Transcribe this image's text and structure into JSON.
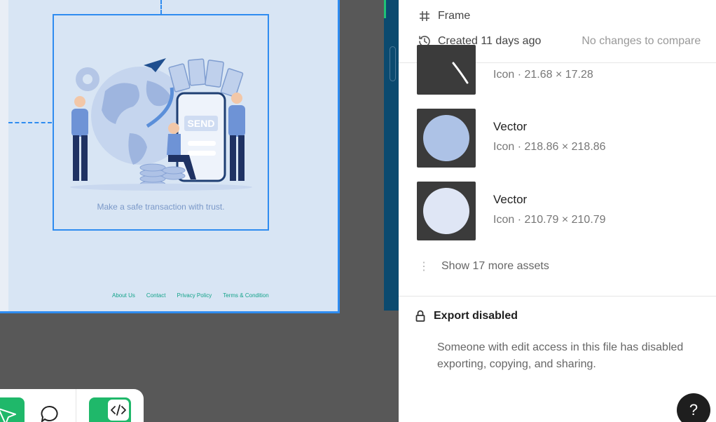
{
  "canvas": {
    "caption": "Make a safe transaction with trust.",
    "send_label": "SEND",
    "footer_links": [
      "About Us",
      "Contact",
      "Privacy Policy",
      "Terms & Condition"
    ]
  },
  "toolbar": {
    "tools": [
      "move-tool",
      "comment-tool",
      "dev-mode-toggle"
    ]
  },
  "panel": {
    "frame_label": "Frame",
    "created": "Created 11 days ago",
    "compare": "No changes to compare",
    "assets": [
      {
        "name": "",
        "meta": "Icon · 21.68 × 17.28",
        "swatch": "#3b3b3b"
      },
      {
        "name": "Vector",
        "meta": "Icon · 218.86 × 218.86",
        "swatch": "#adc2e6"
      },
      {
        "name": "Vector",
        "meta": "Icon · 210.79 × 210.79",
        "swatch": "#dfe6f5"
      }
    ],
    "show_more": "Show 17 more assets",
    "export_title": "Export disabled",
    "export_desc": "Someone with edit access in this file has disabled exporting, copying, and sharing.",
    "help": "?"
  },
  "colors": {
    "selection": "#2f8cf0",
    "accent_green": "#1fb86a",
    "frame_bg": "#d8e5f4"
  }
}
